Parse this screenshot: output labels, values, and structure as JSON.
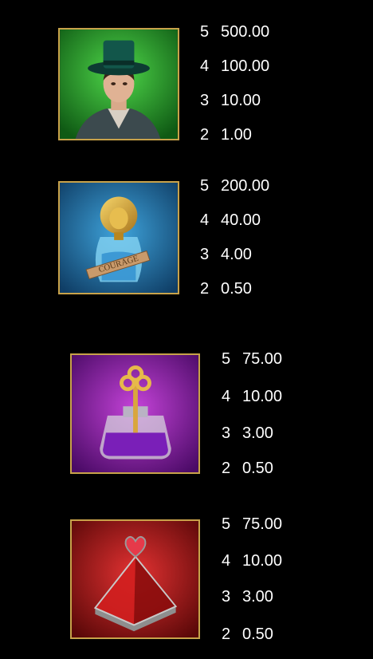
{
  "symbols": [
    {
      "name": "Gentleman in Top Hat",
      "background": "#1f8a2a",
      "payouts": [
        {
          "count": "5",
          "value": "500.00"
        },
        {
          "count": "4",
          "value": "100.00"
        },
        {
          "count": "3",
          "value": "10.00"
        },
        {
          "count": "2",
          "value": "1.00"
        }
      ]
    },
    {
      "name": "Courage Lion Bottle",
      "background": "#1b6fa5",
      "label_on_art": "COURAGE",
      "payouts": [
        {
          "count": "5",
          "value": "200.00"
        },
        {
          "count": "4",
          "value": "40.00"
        },
        {
          "count": "3",
          "value": "4.00"
        },
        {
          "count": "2",
          "value": "0.50"
        }
      ]
    },
    {
      "name": "Purple Key Potion",
      "background": "#8a1fa5",
      "payouts": [
        {
          "count": "5",
          "value": "75.00"
        },
        {
          "count": "4",
          "value": "10.00"
        },
        {
          "count": "3",
          "value": "3.00"
        },
        {
          "count": "2",
          "value": "0.50"
        }
      ]
    },
    {
      "name": "Red Heart Pyramid",
      "background": "#b51c1c",
      "payouts": [
        {
          "count": "5",
          "value": "75.00"
        },
        {
          "count": "4",
          "value": "10.00"
        },
        {
          "count": "3",
          "value": "3.00"
        },
        {
          "count": "2",
          "value": "0.50"
        }
      ]
    }
  ]
}
